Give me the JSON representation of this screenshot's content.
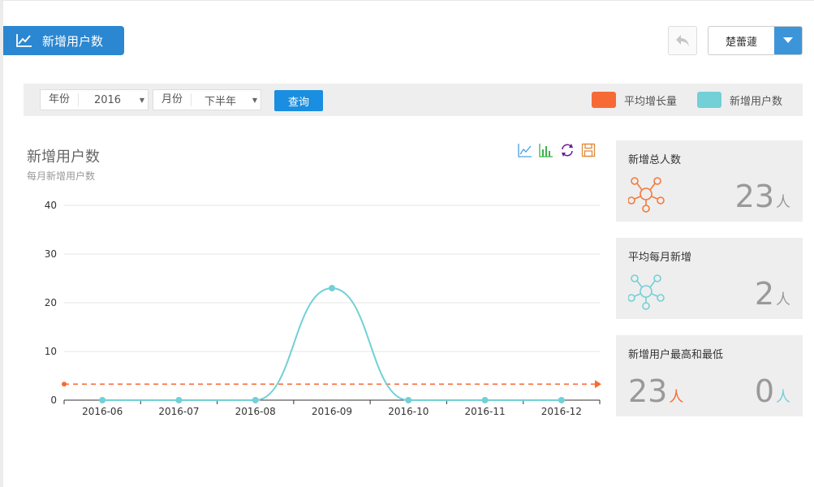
{
  "header": {
    "tab_title": "新增用户数"
  },
  "toolbar": {
    "back_label": "",
    "user_name": "楚蕾蘧"
  },
  "filters": {
    "year_label": "年份",
    "year_value": "2016",
    "month_label": "月份",
    "month_value": "下半年",
    "query_label": "查询"
  },
  "legend": [
    {
      "label": "平均增长量",
      "color": "#f76a36"
    },
    {
      "label": "新增用户数",
      "color": "#72d0d6"
    }
  ],
  "chart": {
    "title": "新增用户数",
    "subtitle": "每月新增用户数",
    "toolbox_icons": [
      "line-chart-icon",
      "bar-chart-icon",
      "refresh-icon",
      "save-icon"
    ]
  },
  "chart_data": {
    "type": "line",
    "categories": [
      "2016-06",
      "2016-07",
      "2016-08",
      "2016-09",
      "2016-10",
      "2016-11",
      "2016-12"
    ],
    "series": [
      {
        "name": "新增用户数",
        "values": [
          0,
          0,
          0,
          23,
          0,
          0,
          0
        ],
        "color": "#72d0d6",
        "smooth": true
      },
      {
        "name": "平均增长量",
        "values": [
          3.3,
          3.3,
          3.3,
          3.3,
          3.3,
          3.3,
          3.3
        ],
        "color": "#f76a36",
        "dashed": true
      }
    ],
    "yticks": [
      0,
      10,
      20,
      30,
      40
    ],
    "ylim": [
      0,
      40
    ],
    "grid": true
  },
  "stats": [
    {
      "title": "新增总人数",
      "value": "23",
      "unit": "人",
      "icon": "network-icon",
      "color": "#f27a3b"
    },
    {
      "title": "平均每月新增",
      "value": "2",
      "unit": "人",
      "icon": "network-icon",
      "color": "#72d0d6"
    },
    {
      "title": "新增用户最高和最低",
      "max_value": "23",
      "max_unit": "人",
      "min_value": "0",
      "min_unit": "人",
      "max_color": "#f76a36",
      "min_color": "#72d0d6"
    }
  ]
}
